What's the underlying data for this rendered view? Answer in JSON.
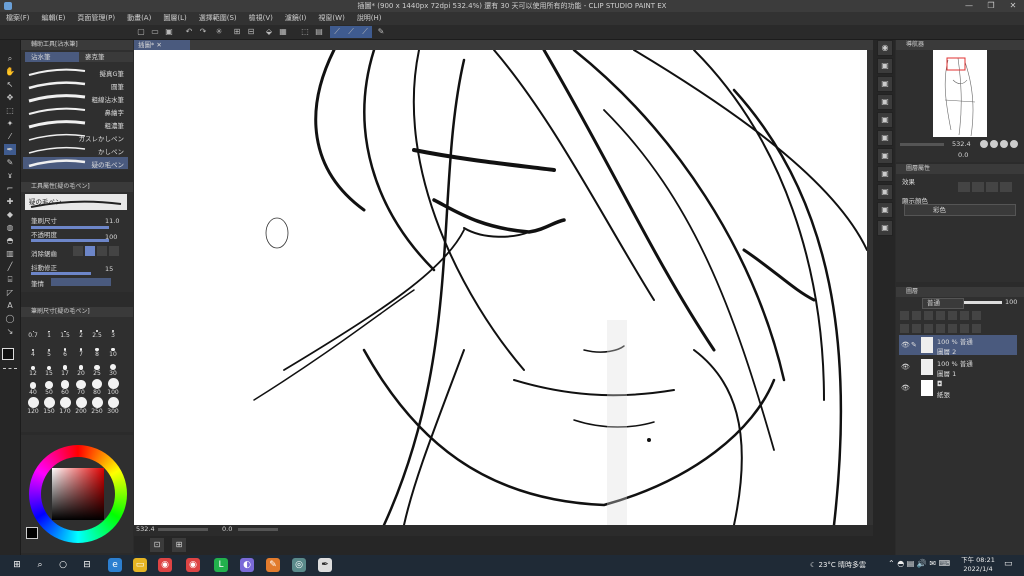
{
  "window": {
    "title": "插圖* (900 x 1440px 72dpi 532.4%)  還有 30 天可以使用所有的功能 - CLIP STUDIO PAINT EX",
    "controls": [
      "—",
      "❐",
      "✕"
    ]
  },
  "menu": [
    "檔案(F)",
    "編輯(E)",
    "頁面管理(P)",
    "動畫(A)",
    "圖層(L)",
    "選擇範圍(S)",
    "檢視(V)",
    "濾鏡(I)",
    "視窗(W)",
    "說明(H)"
  ],
  "canvas_tab": "插圖*",
  "sub_tool_panel": {
    "header": "輔助工具[沾水筆]",
    "tabs": [
      "沾水筆",
      "麥克筆"
    ],
    "brushes": [
      "擬真G筆",
      "圓筆",
      "粗線沾水筆",
      "鼻繪字",
      "粗濃筆",
      "カスレかしペン",
      "かしペン",
      "疑の毛ペン"
    ],
    "selected_brush_index": 7
  },
  "tool_property": {
    "header": "工具屬性[疑の毛ペン]",
    "brush_name": "疑の毛ペン",
    "rows": [
      {
        "label": "筆刷尺寸",
        "value": "11.0"
      },
      {
        "label": "不透明度",
        "value": "100"
      },
      {
        "label": "消除鋸齒",
        "value": ""
      },
      {
        "label": "抖動修正",
        "value": "15"
      },
      {
        "label": "筆情",
        "value": ""
      }
    ]
  },
  "brush_size_panel": {
    "header": "筆刷尺寸[疑の毛ペン]",
    "sizes": [
      "0.7",
      "1",
      "1.5",
      "2",
      "2.5",
      "3",
      "4",
      "5",
      "6",
      "7",
      "8",
      "10",
      "12",
      "15",
      "17",
      "20",
      "25",
      "30",
      "40",
      "50",
      "60",
      "70",
      "80",
      "100",
      "120",
      "150",
      "170",
      "200",
      "250",
      "300"
    ]
  },
  "status_bar": {
    "zoom": "532.4",
    "angle": "0.0"
  },
  "navigator": {
    "header": "導航器",
    "zoom": "532.4",
    "angle": "0.0"
  },
  "layer_property": {
    "header": "圖層屬性",
    "effect_label": "效果",
    "display_color_label": "顯示顏色",
    "display_color_value": "彩色"
  },
  "layers_panel": {
    "header": "圖層",
    "blend_mode": "普通",
    "opacity": "100",
    "layers": [
      {
        "opacity_mode": "100 % 普通",
        "name": "圖層 2",
        "selected": true
      },
      {
        "opacity_mode": "100 % 普通",
        "name": "圖層 1",
        "selected": false
      },
      {
        "opacity_mode": "",
        "name": "紙張",
        "selected": false
      }
    ]
  },
  "taskbar": {
    "weather": "23°C  晴時多雲",
    "time": "下午 08:21",
    "date": "2022/1/4"
  },
  "colors": {
    "accent": "#6d86c9",
    "selected_layer": "#4a5a7e",
    "panel": "#2f2f2f",
    "taskbar": "#1f2a36"
  }
}
